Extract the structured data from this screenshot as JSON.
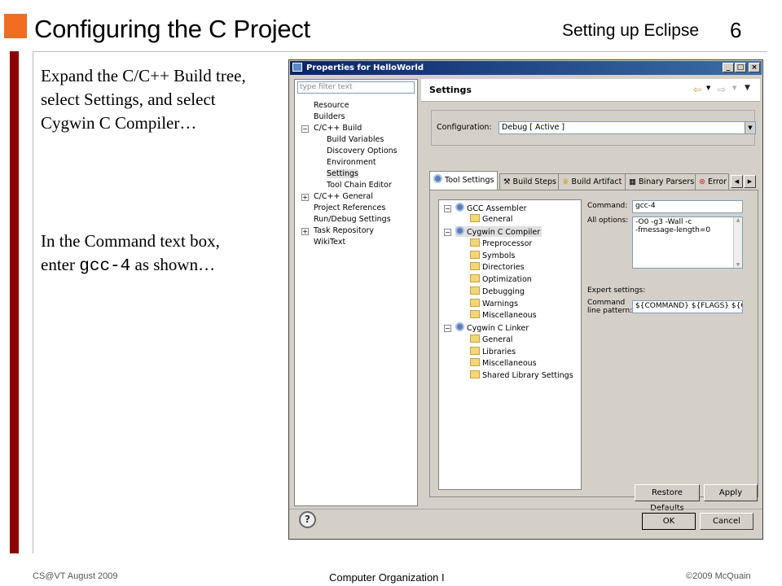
{
  "slide": {
    "title": "Configuring the C Project",
    "subtitle": "Setting up Eclipse",
    "number": "6",
    "text1": "Expand the C/C++ Build tree, select Settings, and select Cygwin C Compiler…",
    "text2_a": "In the Command text box, enter ",
    "text2_code": "gcc-4",
    "text2_b": " as shown…",
    "footer_left": "CS@VT August 2009",
    "footer_center": "Computer Organization I",
    "footer_right": "©2009 McQuain"
  },
  "dialog": {
    "title": "Properties for HelloWorld",
    "filter_placeholder": "type filter text",
    "tree": [
      {
        "label": "Resource"
      },
      {
        "label": "Builders"
      },
      {
        "label": "C/C++ Build"
      },
      {
        "label": "Build Variables"
      },
      {
        "label": "Discovery Options"
      },
      {
        "label": "Environment"
      },
      {
        "label": "Settings"
      },
      {
        "label": "Tool Chain Editor"
      },
      {
        "label": "C/C++ General"
      },
      {
        "label": "Project References"
      },
      {
        "label": "Run/Debug Settings"
      },
      {
        "label": "Task Repository"
      },
      {
        "label": "WikiText"
      }
    ],
    "header_title": "Settings",
    "configuration_label": "Configuration:",
    "configuration_value": "Debug  [ Active ]",
    "tabs": [
      "Tool Settings",
      "Build Steps",
      "Build Artifact",
      "Binary Parsers",
      "Error"
    ],
    "opt_tree": [
      {
        "label": "GCC Assembler"
      },
      {
        "label": "General"
      },
      {
        "label": "Cygwin C Compiler"
      },
      {
        "label": "Preprocessor"
      },
      {
        "label": "Symbols"
      },
      {
        "label": "Directories"
      },
      {
        "label": "Optimization"
      },
      {
        "label": "Debugging"
      },
      {
        "label": "Warnings"
      },
      {
        "label": "Miscellaneous"
      },
      {
        "label": "Cygwin C Linker"
      },
      {
        "label": "General"
      },
      {
        "label": "Libraries"
      },
      {
        "label": "Miscellaneous"
      },
      {
        "label": "Shared Library Settings"
      }
    ],
    "command_label": "Command:",
    "command_value": "gcc-4",
    "all_options_label": "All options:",
    "all_options_value1": "-O0 -g3 -Wall -c",
    "all_options_value2": "-fmessage-length=0",
    "expert_label": "Expert settings:",
    "pattern_label1": "Command",
    "pattern_label2": "line pattern:",
    "pattern_value": "${COMMAND} ${FLAGS} ${OU",
    "restore_defaults": "Restore Defaults",
    "apply": "Apply",
    "ok": "OK",
    "cancel": "Cancel",
    "help_symbol": "?",
    "minimize_symbol": "_",
    "maximize_symbol": "□",
    "close_symbol": "×"
  }
}
